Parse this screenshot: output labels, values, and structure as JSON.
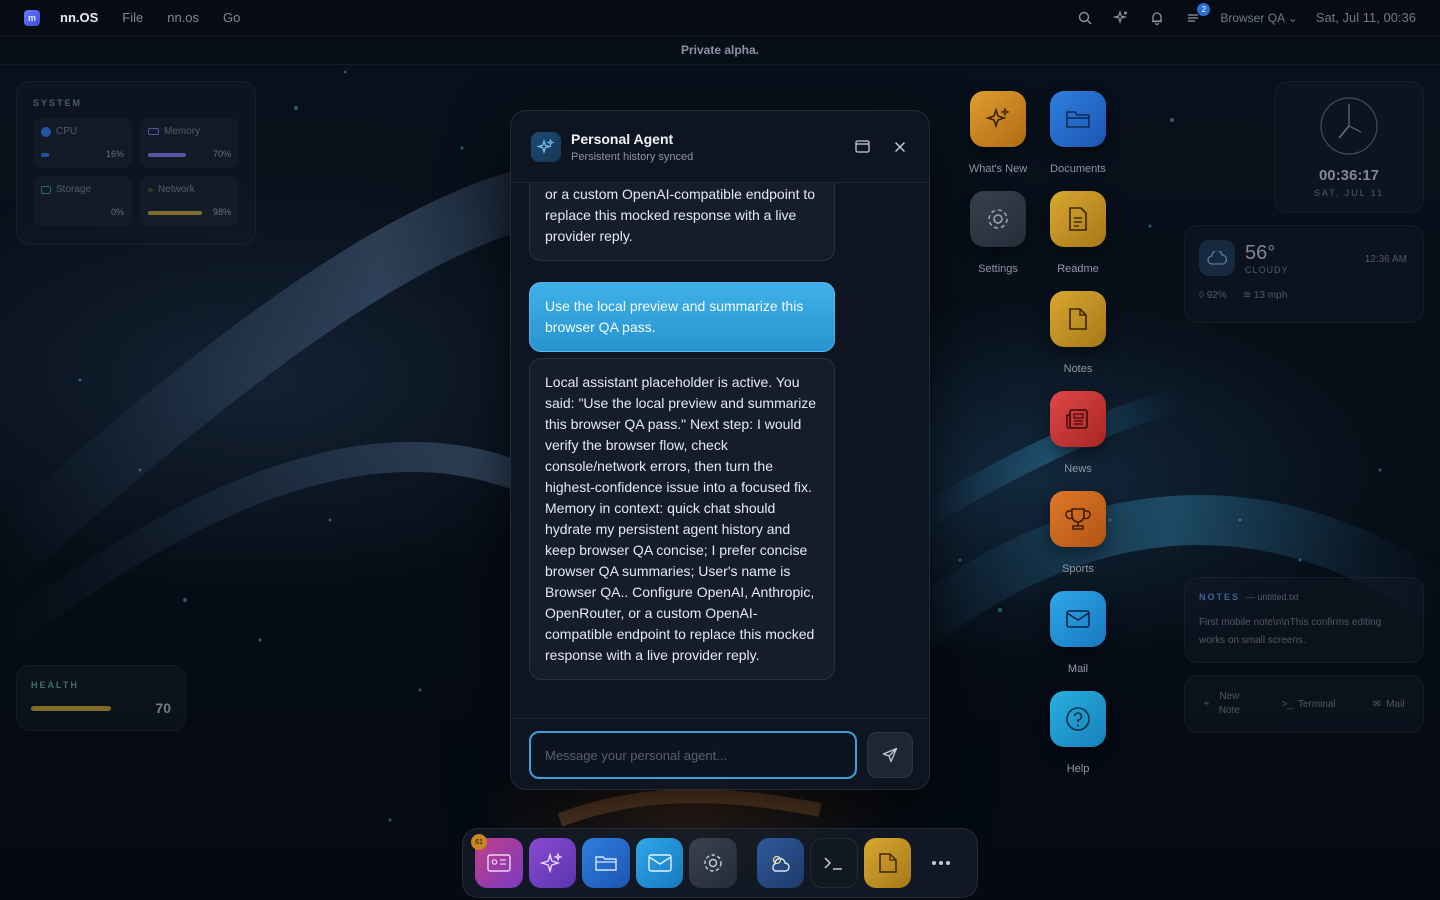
{
  "menubar": {
    "brand": "nn.OS",
    "menus": [
      "File",
      "nn.os",
      "Go"
    ],
    "notification_count": "2",
    "profile": "Browser QA",
    "datetime": "Sat, Jul 11, 00:36"
  },
  "banner": "Private alpha.",
  "system": {
    "title": "SYSTEM",
    "cpu": {
      "label": "CPU",
      "value": "16%",
      "level": 0.16
    },
    "memory": {
      "label": "Memory",
      "value": "70%",
      "level": 0.7
    },
    "storage": {
      "label": "Storage",
      "value": "0%",
      "level": 0.0
    },
    "network": {
      "label": "Network",
      "value": "98%",
      "level": 0.98
    }
  },
  "health": {
    "title": "HEALTH",
    "value": "70",
    "level": 0.7
  },
  "clock": {
    "time": "00:36:17",
    "date": "SAT, JUL 11"
  },
  "weather": {
    "temp": "56°",
    "condition": "CLOUDY",
    "time": "12:36 AM",
    "humidity": "92%",
    "wind": "13 mph"
  },
  "notes": {
    "title": "NOTES",
    "file": "— untitled.txt",
    "body": "First mobile note\\n\\nThis confirms editing works on small screens."
  },
  "quick_actions": {
    "new_note": "New Note",
    "terminal": "Terminal",
    "mail": "Mail"
  },
  "desktop": {
    "whats_new": "What's New",
    "documents": "Documents",
    "settings": "Settings",
    "readme": "Readme",
    "notes": "Notes",
    "news": "News",
    "sports": "Sports",
    "mail": "Mail",
    "help": "Help"
  },
  "agent": {
    "title": "Personal Agent",
    "subtitle": "Persistent history synced",
    "messages": [
      {
        "role": "assistant",
        "text": "Configure OpenAI, Anthropic, OpenRouter, or a custom OpenAI-compatible endpoint to replace this mocked response with a live provider reply."
      },
      {
        "role": "user",
        "text": "Use the local preview and summarize this browser QA pass."
      },
      {
        "role": "assistant",
        "text": "Local assistant placeholder is active. You said: \"Use the local preview and summarize this browser QA pass.\" Next step: I would verify the browser flow, check console/network errors, then turn the highest-confidence issue into a focused fix. Memory in context: quick chat should hydrate my persistent agent history and keep browser QA concise; I prefer concise browser QA summaries; User's name is Browser QA.. Configure OpenAI, Anthropic, OpenRouter, or a custom OpenAI-compatible endpoint to replace this mocked response with a live provider reply."
      }
    ],
    "placeholder": "Message your personal agent..."
  },
  "dock": {
    "badge": "61"
  },
  "colors": {
    "accent": "#3d9fd8",
    "user_bubble": "#2f9fd9",
    "health": "#b09030"
  }
}
